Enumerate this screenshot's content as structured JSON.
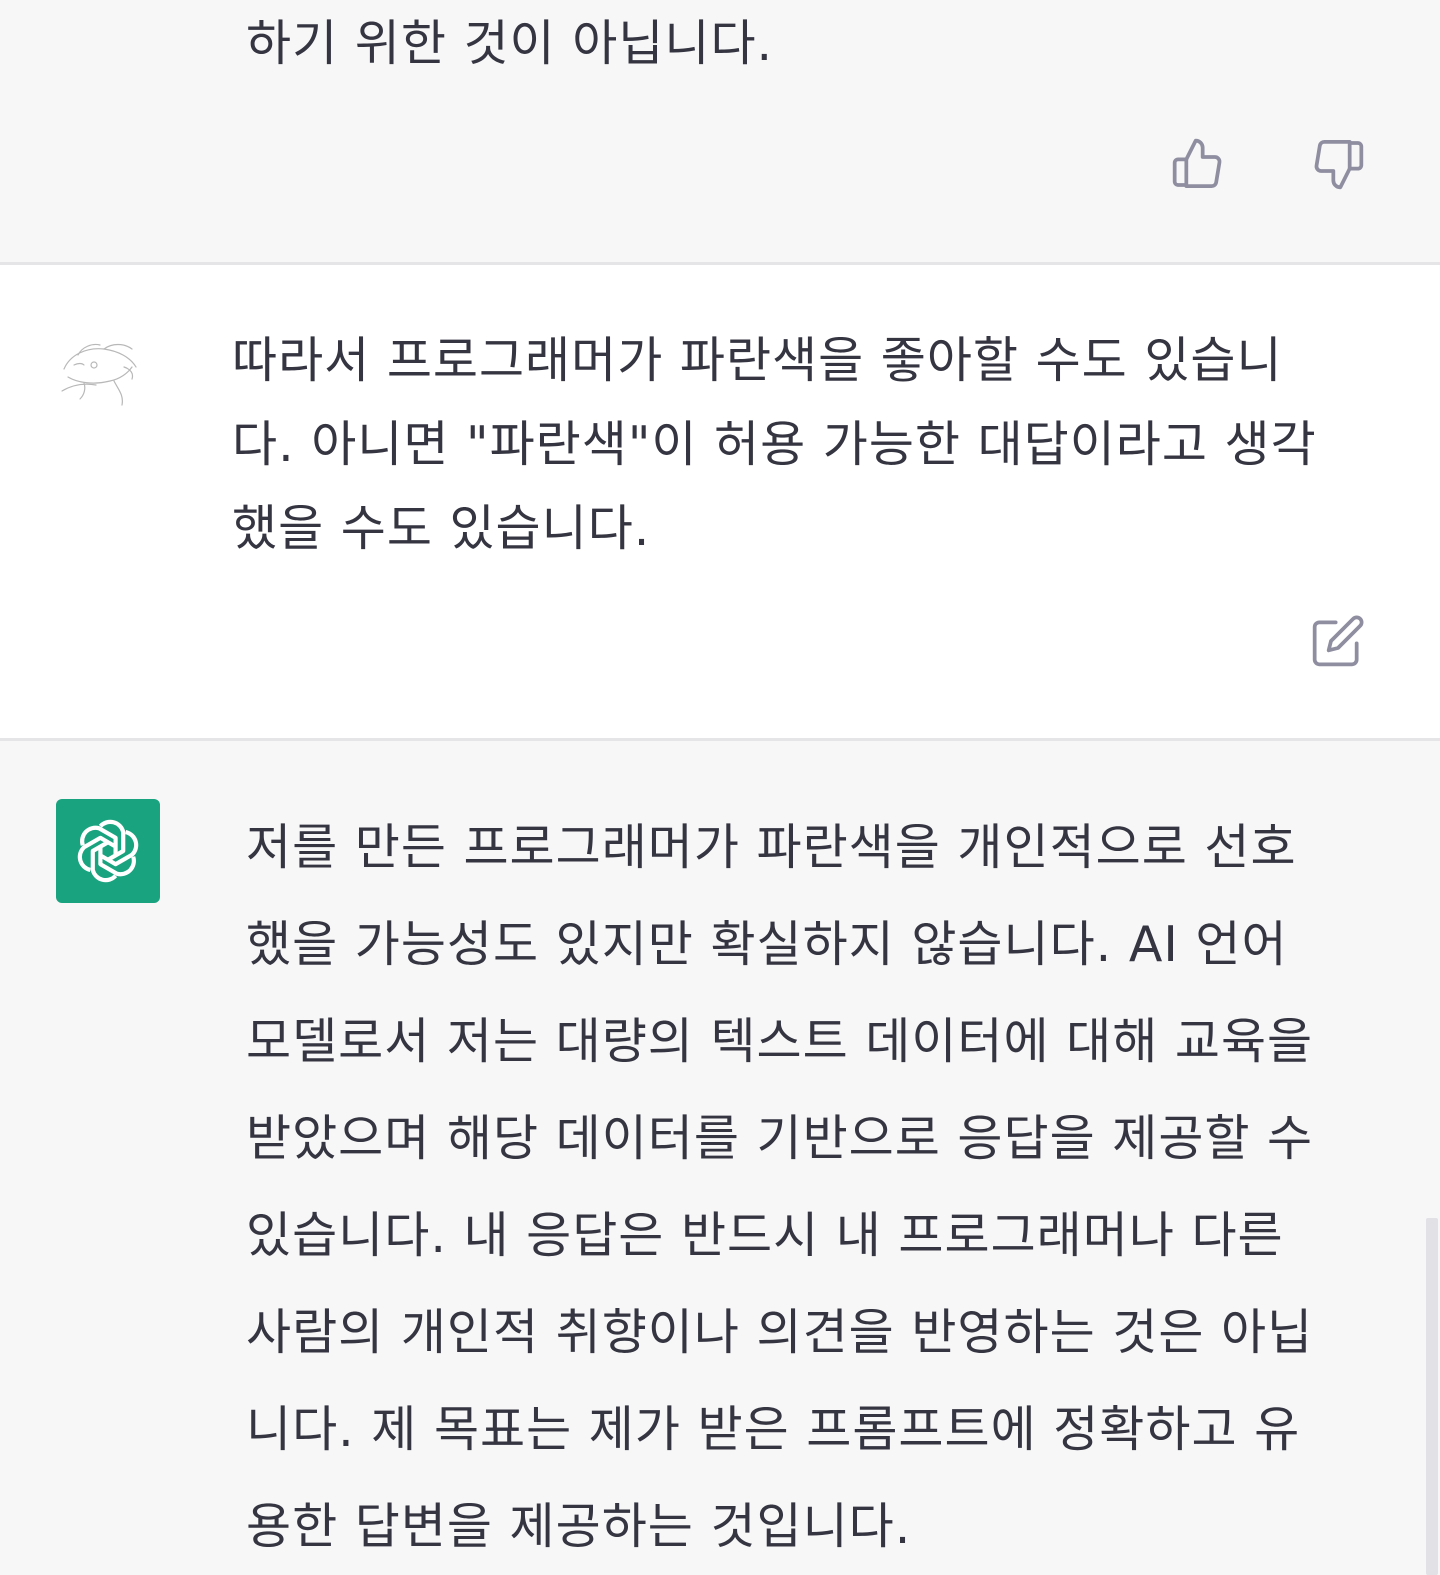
{
  "messages": {
    "previous_assistant": {
      "text": "하기 위한 것이 아닙니다.",
      "feedback": {
        "thumbs_up": "thumbs-up-icon",
        "thumbs_down": "thumbs-down-icon"
      }
    },
    "user": {
      "text": "따라서 프로그래머가 파란색을 좋아할 수도 있습니\n다. 아니면 \"파란색\"이 허용 가능한 대답이라고 생각\n했을 수도 있습니다.",
      "edit_icon": "edit-icon"
    },
    "assistant": {
      "text": "저를 만든 프로그래머가 파란색을 개인적으로 선호\n했을 가능성도 있지만 확실하지 않습니다. AI 언어\n모델로서 저는 대량의 텍스트 데이터에 대해 교육을\n받았으며 해당 데이터를 기반으로 응답을 제공할 수\n있습니다. 내 응답은 반드시 내 프로그래머나 다른\n사람의 개인적 취향이나 의견을 반영하는 것은 아닙\n니다. 제 목표는 제가 받은 프롬프트에 정확하고 유\n용한 답변을 제공하는 것입니다.",
      "logo": "openai-logo-icon",
      "brand_color": "#19a37f"
    }
  }
}
